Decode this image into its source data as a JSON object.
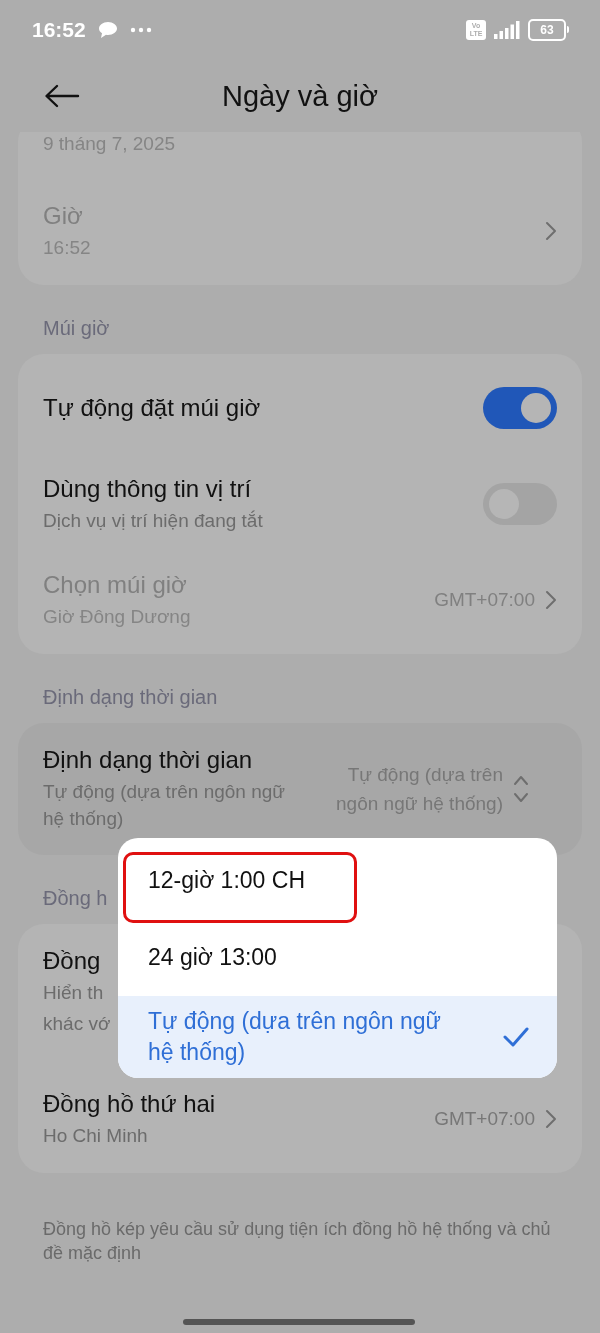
{
  "status_bar": {
    "time": "16:52",
    "network_badge": [
      "Vo",
      "LTE"
    ],
    "battery": "63"
  },
  "header": {
    "title": "Ngày và giờ"
  },
  "sections": [
    {
      "rows": [
        {
          "kind": "text",
          "subtitle": "9 tháng 7, 2025",
          "disabled": true
        },
        {
          "kind": "link",
          "title": "Giờ",
          "subtitle": "16:52",
          "disabled": true
        }
      ]
    },
    {
      "label": "Múi giờ",
      "rows": [
        {
          "kind": "toggle",
          "title": "Tự động đặt múi giờ",
          "on": true,
          "disabled": false
        },
        {
          "kind": "toggle",
          "title": "Dùng thông tin vị trí",
          "subtitle": "Dịch vụ vị trí hiện đang tắt",
          "on": false,
          "disabled": false
        },
        {
          "kind": "link",
          "title": "Chọn múi giờ",
          "subtitle": "Giờ Đông Dương",
          "value": "GMT+07:00",
          "disabled": true
        }
      ]
    },
    {
      "label": "Định dạng thời gian",
      "pressed": true,
      "rows": [
        {
          "kind": "select",
          "title": "Định dạng thời gian",
          "subtitle": "Tự động (dựa trên ngôn ngữ hệ thống)",
          "value": "Tự động (dựa trên ngôn ngữ hệ thống)",
          "disabled": false
        }
      ]
    },
    {
      "label": "Đồng h",
      "rows": [
        {
          "kind": "text",
          "title": "Đồng",
          "subtitle_lines": [
            "Hiển th",
            "khác vớ"
          ],
          "disabled": false
        },
        {
          "kind": "link",
          "title": "Đồng hồ thứ hai",
          "subtitle": "Ho Chi Minh",
          "value": "GMT+07:00",
          "disabled": false
        }
      ]
    }
  ],
  "footer_note": "Đồng hồ kép yêu cầu sử dụng tiện ích đồng hồ hệ thống và chủ đề mặc định",
  "popup": {
    "options": [
      {
        "label": "12-giờ 1:00 CH",
        "selected": false,
        "highlighted": true
      },
      {
        "label": "24 giờ 13:00",
        "selected": false,
        "highlighted": false
      },
      {
        "label": "Tự động (dựa trên ngôn ngữ hệ thống)",
        "selected": true,
        "highlighted": false
      }
    ]
  }
}
